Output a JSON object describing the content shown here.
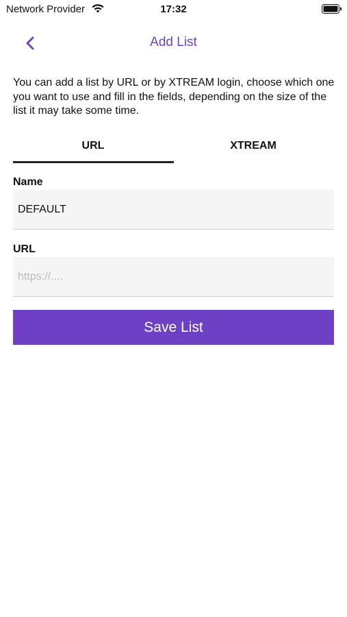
{
  "status_bar": {
    "carrier": "Network Provider",
    "time": "17:32",
    "wifi_icon": "wifi-icon",
    "battery_icon": "battery-icon"
  },
  "nav": {
    "back_icon": "chevron-left-icon",
    "title": "Add List"
  },
  "description": "You can add a list by URL or by XTREAM login, choose which one you want to use and fill in the fields, depending on the size of the list it may take some time.",
  "tabs": [
    {
      "label": "URL",
      "selected": true
    },
    {
      "label": "XTREAM",
      "selected": false
    }
  ],
  "form": {
    "name_label": "Name",
    "name_value": "DEFAULT",
    "url_label": "URL",
    "url_value": "",
    "url_placeholder": "https://...."
  },
  "save_button": "Save List",
  "colors": {
    "accent": "#6e40c3",
    "field_background": "#f5f5f5",
    "tab_indicator": "#222222"
  }
}
